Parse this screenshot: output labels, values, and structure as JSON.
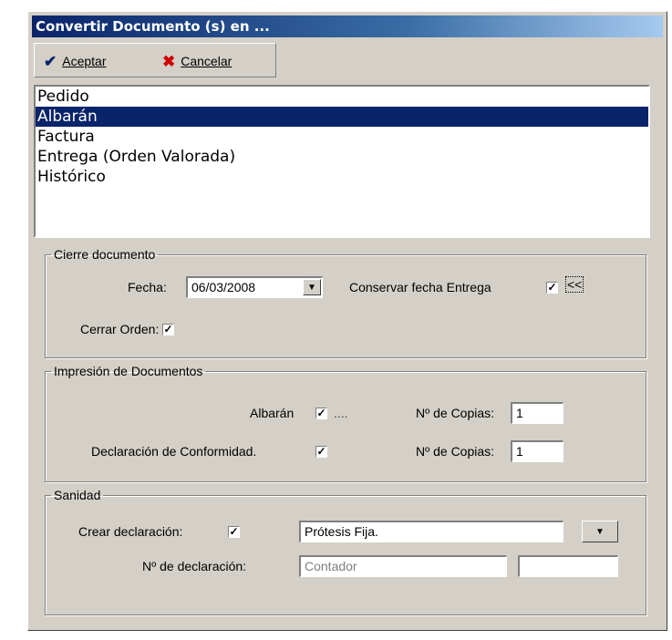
{
  "window": {
    "title": "Convertir Documento (s) en ..."
  },
  "toolbar": {
    "accept_label": "Aceptar",
    "accept_icon": "checkmark-icon",
    "accept_icon_color": "#0a246a",
    "cancel_label": "Cancelar",
    "cancel_icon": "x-icon",
    "cancel_icon_color": "#d00000"
  },
  "document_types": {
    "items": [
      "Pedido",
      "Albarán",
      "Factura",
      "Entrega (Orden Valorada)",
      "Histórico"
    ],
    "selected": "Albarán"
  },
  "cierre": {
    "legend": "Cierre documento",
    "fecha_label": "Fecha:",
    "fecha_value": "06/03/2008",
    "conservar_label": "Conservar fecha Entrega",
    "conservar_checked": true,
    "collapse_label": "<<",
    "cerrar_label": "Cerrar Orden:",
    "cerrar_checked": true
  },
  "impresion": {
    "legend": "Impresión de Documentos",
    "albaran_label": "Albarán",
    "albaran_checked": true,
    "albaran_ellipsis": "....",
    "copias_label_1": "Nº de Copias:",
    "copias_value_1": "1",
    "conformidad_label": "Declaración de Conformidad.",
    "conformidad_checked": true,
    "copias_label_2": "Nº de Copias:",
    "copias_value_2": "1"
  },
  "sanidad": {
    "legend": "Sanidad",
    "crear_label": "Crear declaración:",
    "crear_checked": true,
    "tipo_value": "Prótesis Fija.",
    "num_label": "Nº de declaración:",
    "num_placeholder": "Contador",
    "num_extra": ""
  },
  "colors": {
    "dialog_bg": "#d4d0c8",
    "title_gradient_start": "#0a246a",
    "title_gradient_end": "#a6caf0",
    "selection_bg": "#0a246a"
  }
}
